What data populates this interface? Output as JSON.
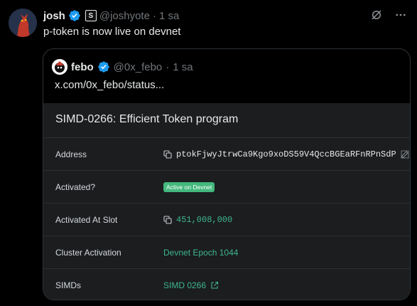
{
  "tweet": {
    "name": "josh",
    "handle": "@joshyote",
    "sep": "·",
    "time": "1 sa",
    "text": "p-token is now live on devnet"
  },
  "quote": {
    "name": "febo",
    "handle": "@0x_febo",
    "sep": "·",
    "time": "1 sa",
    "text": "x.com/0x_febo/status..."
  },
  "panel": {
    "title": "SIMD-0266: Efficient Token program",
    "rows": [
      {
        "label": "Address",
        "value": "ptokFjwyJtrwCa9Kgo9xoDS59V4QccBGEaRFnRPnSdP"
      },
      {
        "label": "Activated?",
        "value": "Active on Devnet"
      },
      {
        "label": "Activated At Slot",
        "value": "451,008,000"
      },
      {
        "label": "Cluster Activation",
        "value": "Devnet Epoch 1044"
      },
      {
        "label": "SIMDs",
        "value": "SIMD 0266"
      }
    ]
  },
  "colors": {
    "verified": "#1d9bf0",
    "accent_green": "#3fb58f",
    "pill_green": "#44b87d",
    "panel_bg": "#1b1d1f"
  },
  "icons": [
    "verified-icon",
    "grok-icon",
    "more-icon",
    "copy-icon",
    "edit-icon",
    "external-link-icon"
  ]
}
